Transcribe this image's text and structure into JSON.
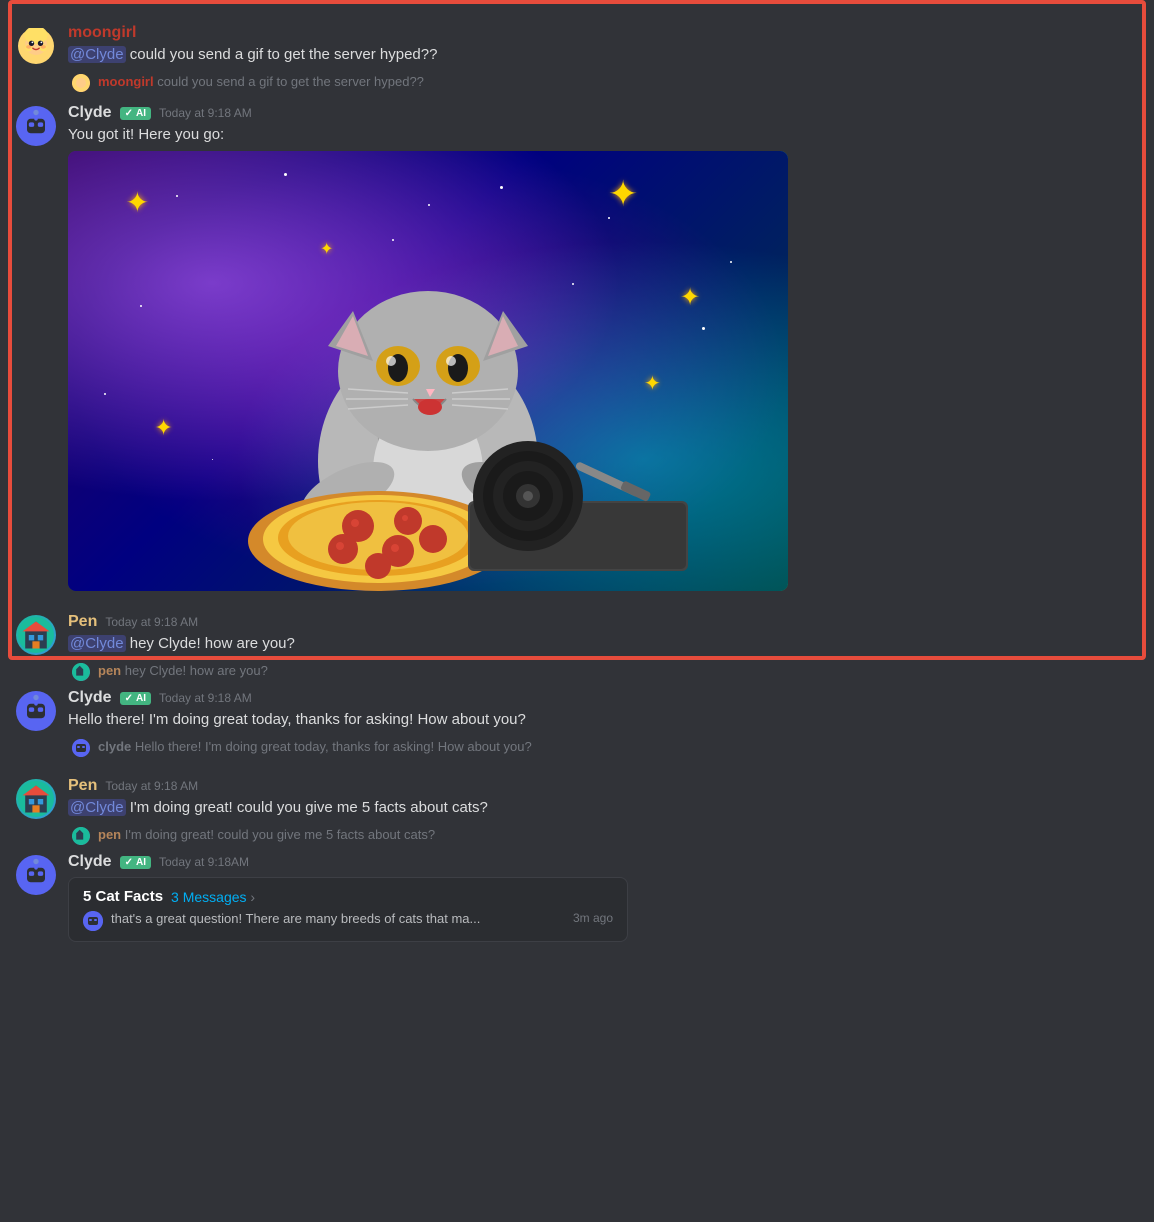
{
  "messages": [
    {
      "id": "msg1",
      "author": "moongirl",
      "username": "moongirl",
      "usernameColor": "moongirl",
      "timestamp": "",
      "content": "@Clyde could you send a gif to get the server hyped??",
      "mention": "@Clyde",
      "afterMention": " could you send a gif to get the server hyped??",
      "hasEcho": false,
      "hasImage": false,
      "isBot": false,
      "type": "user"
    },
    {
      "id": "echo1",
      "echoAuthor": "moongirl",
      "echoText": "could you send a gif to get the server hyped??",
      "type": "echo"
    },
    {
      "id": "msg2",
      "author": "clyde",
      "username": "Clyde",
      "usernameColor": "clyde",
      "timestamp": "Today at 9:18 AM",
      "content": "You got it! Here you go:",
      "isBot": true,
      "aiBadge": "AI",
      "hasImage": true,
      "imageAlt": "Cat DJ GIF",
      "type": "user"
    },
    {
      "id": "msg3",
      "author": "pen",
      "username": "Pen",
      "usernameColor": "pen",
      "timestamp": "Today at 9:18 AM",
      "mentionText": "@Clyde",
      "afterMention": " hey Clyde! how are you?",
      "type": "user"
    },
    {
      "id": "echo2",
      "echoAuthor": "pen",
      "echoText": "hey Clyde! how are you?",
      "type": "echo"
    },
    {
      "id": "msg4",
      "author": "clyde",
      "username": "Clyde",
      "usernameColor": "clyde",
      "timestamp": "Today at 9:18 AM",
      "content": "Hello there! I'm doing great today, thanks for asking! How about you?",
      "isBot": true,
      "aiBadge": "AI",
      "type": "user"
    },
    {
      "id": "echo3",
      "echoAuthor": "clyde",
      "echoText": "Hello there! I'm doing great today, thanks for asking! How about you?",
      "type": "echo"
    },
    {
      "id": "msg5",
      "author": "pen",
      "username": "Pen",
      "usernameColor": "pen",
      "timestamp": "Today at 9:18 AM",
      "mentionText": "@Clyde",
      "afterMention": " I'm doing great! could you give me 5 facts about cats?",
      "type": "user"
    },
    {
      "id": "echo4",
      "echoAuthor": "pen",
      "echoText": "I'm doing great! could you give me 5 facts about cats?",
      "type": "echo"
    },
    {
      "id": "msg6",
      "author": "clyde",
      "username": "Clyde",
      "usernameColor": "clyde",
      "timestamp": "Today at 9:18AM",
      "content": "",
      "isBot": true,
      "aiBadge": "AI",
      "hasThread": true,
      "threadTitle": "5 Cat Facts",
      "threadMessages": "3 Messages",
      "threadPreviewText": "that's a great question! There are many breeds of cats that ma...",
      "threadPreviewTime": "3m ago",
      "type": "user"
    }
  ],
  "ui": {
    "mentionBgColor": "rgba(88, 101, 242, 0.3)",
    "mentionTextColor": "#7289da",
    "highlightBorderColor": "#e74c3c",
    "botBadgeLabel": "AI",
    "arrowLabel": ">"
  }
}
